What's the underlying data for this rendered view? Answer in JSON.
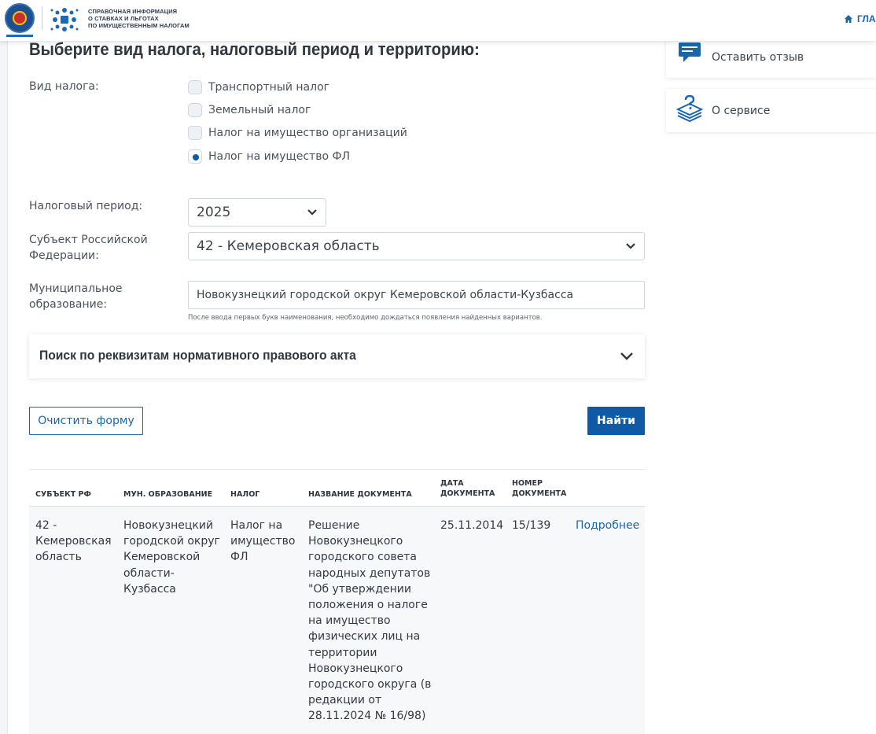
{
  "header": {
    "logo_text_lines": [
      "СПРАВОЧНАЯ ИНФОРМАЦИЯ",
      "О СТАВКАХ И ЛЬГОТАХ",
      "ПО ИМУЩЕСТВЕННЫМ НАЛОГАМ"
    ],
    "home_label": "ГЛА"
  },
  "page_title": "Выберите вид налога, налоговый период и территорию:",
  "tax_type": {
    "label": "Вид налога:",
    "options": [
      {
        "label": "Транспортный налог",
        "checked": false
      },
      {
        "label": "Земельный налог",
        "checked": false
      },
      {
        "label": "Налог на имущество организаций",
        "checked": false
      },
      {
        "label": "Налог на имущество ФЛ",
        "checked": true
      }
    ]
  },
  "period": {
    "label": "Налоговый период:",
    "value": "2025"
  },
  "subject": {
    "label_line1": "Субъект Российской",
    "label_line2": "Федерации:",
    "value": "42 - Кемеровская область"
  },
  "municipality": {
    "label_line1": "Муниципальное",
    "label_line2": "образование:",
    "value": "Новокузнецкий городской округ Кемеровской области-Кузбасса",
    "hint": "После ввода первых букв наименования, необходимо дождаться появления найденных вариантов."
  },
  "accordion": {
    "title": "Поиск по реквизитам нормативного правового акта"
  },
  "buttons": {
    "clear": "Очистить форму",
    "find": "Найти"
  },
  "table": {
    "headers": {
      "subject": "СУБЪЕКТ РФ",
      "municipality": "МУН. ОБРАЗОВАНИЕ",
      "tax": "НАЛОГ",
      "doc_name": "НАЗВАНИЕ ДОКУМЕНТА",
      "doc_date_1": "ДАТА",
      "doc_date_2": "ДОКУМЕНТА",
      "doc_num_1": "НОМЕР",
      "doc_num_2": "ДОКУМЕНТА"
    },
    "row": {
      "subject": [
        "42 -",
        "Кемеровская",
        "область"
      ],
      "municipality": [
        "Новокузнецкий",
        "городской округ",
        "Кемеровской",
        "области-",
        "Кузбасса"
      ],
      "tax": [
        "Налог на",
        "имущество",
        "ФЛ"
      ],
      "doc_name": [
        "Решение",
        "Новокузнецкого",
        "городского совета",
        "народных депутатов",
        "\"Об утверждении",
        "положения о налоге",
        "на имущество",
        "физических лиц на",
        "территории",
        "Новокузнецкого",
        "городского округа (в",
        "редакции от",
        "28.11.2024 № 16/98)"
      ],
      "date": "25.11.2014",
      "number": "15/139",
      "details": "Подробнее"
    }
  },
  "sidebar": {
    "feedback": "Оставить отзыв",
    "about": "О сервисе"
  },
  "colors": {
    "accent": "#0f5aa6",
    "link": "#1866ae",
    "text": "#333a43"
  }
}
